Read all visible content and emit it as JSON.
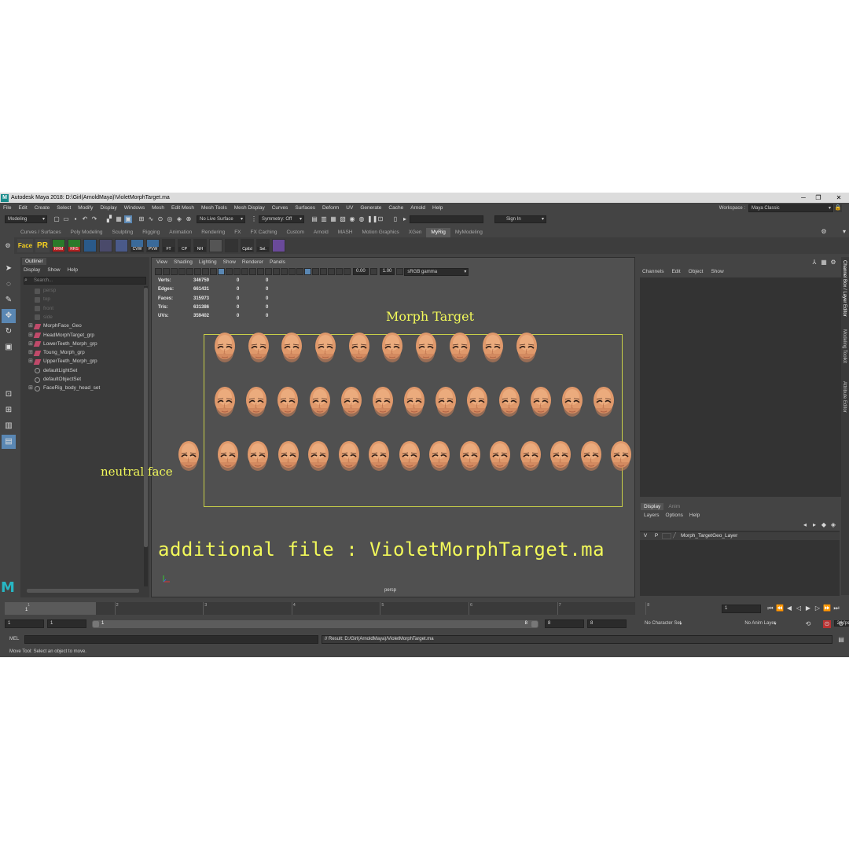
{
  "window": {
    "title": "Autodesk Maya 2018: D:\\Girl(ArnoldMaya)\\VioletMorphTarget.ma",
    "logo": "M"
  },
  "menubar": [
    "File",
    "Edit",
    "Create",
    "Select",
    "Modify",
    "Display",
    "Windows",
    "Mesh",
    "Edit Mesh",
    "Mesh Tools",
    "Mesh Display",
    "Curves",
    "Surfaces",
    "Deform",
    "UV",
    "Generate",
    "Cache",
    "Arnold",
    "Help"
  ],
  "workspace": {
    "label": "Workspace :",
    "value": "Maya Classic"
  },
  "statusline": {
    "mode": "Modeling",
    "live_surface": "No Live Surface",
    "symmetry": "Symmetry: Off",
    "sign_in": "Sign In"
  },
  "shelf_tabs": [
    "Curves / Surfaces",
    "Poly Modeling",
    "Sculpting",
    "Rigging",
    "Animation",
    "Rendering",
    "FX",
    "FX Caching",
    "Custom",
    "Arnold",
    "MASH",
    "Motion Graphics",
    "XGen",
    "MyRig",
    "MyModeling"
  ],
  "shelf_active": "MyRig",
  "shelf_buttons": [
    {
      "label": "Face",
      "icon": "face-icon"
    },
    {
      "label": "PR",
      "icon": "pr-icon"
    },
    {
      "label": "RRM",
      "icon": "rrm-icon"
    },
    {
      "label": "RRS",
      "icon": "rrs-icon"
    },
    {
      "label": "",
      "icon": "arnold-icon"
    },
    {
      "label": "",
      "icon": "grid-icon"
    },
    {
      "label": "",
      "icon": "bone-icon"
    },
    {
      "label": "CVW",
      "icon": "cvw-icon"
    },
    {
      "label": "PVW",
      "icon": "pvw-icon"
    },
    {
      "label": "FT",
      "icon": "ft-icon"
    },
    {
      "label": "CP",
      "icon": "cp-icon"
    },
    {
      "label": "NH",
      "icon": "nh-icon"
    },
    {
      "label": "",
      "icon": "joints-icon"
    },
    {
      "label": "",
      "icon": "script-icon"
    },
    {
      "label": "CpEd",
      "icon": "cped-icon"
    },
    {
      "label": "Sel.",
      "icon": "sel-icon"
    },
    {
      "label": "",
      "icon": "sphere-icon"
    }
  ],
  "outliner": {
    "tab": "Outliner",
    "menu": [
      "Display",
      "Show",
      "Help"
    ],
    "search_placeholder": "Search...",
    "items": [
      {
        "label": "persp",
        "dim": true,
        "expand": false,
        "icon": "camera"
      },
      {
        "label": "top",
        "dim": true,
        "expand": false,
        "icon": "camera"
      },
      {
        "label": "front",
        "dim": true,
        "expand": false,
        "icon": "camera"
      },
      {
        "label": "side",
        "dim": true,
        "expand": false,
        "icon": "camera"
      },
      {
        "label": "MorphFace_Geo",
        "dim": false,
        "expand": true,
        "icon": "group"
      },
      {
        "label": "HeadMorphTarget_grp",
        "dim": false,
        "expand": true,
        "icon": "group"
      },
      {
        "label": "LowerTeeth_Morph_grp",
        "dim": false,
        "expand": true,
        "icon": "group"
      },
      {
        "label": "Toung_Morph_grp",
        "dim": false,
        "expand": true,
        "icon": "group"
      },
      {
        "label": "UpperTeeth_Morph_grp",
        "dim": false,
        "expand": true,
        "icon": "group"
      },
      {
        "label": "defaultLightSet",
        "dim": false,
        "expand": false,
        "icon": "set"
      },
      {
        "label": "defaultObjectSet",
        "dim": false,
        "expand": false,
        "icon": "set"
      },
      {
        "label": "FaceRig_body_head_set",
        "dim": false,
        "expand": true,
        "icon": "set"
      }
    ]
  },
  "viewport": {
    "menu": [
      "View",
      "Shading",
      "Lighting",
      "Show",
      "Renderer",
      "Panels"
    ],
    "exposure": "0.00",
    "gamma": "1.00",
    "color_space": "sRGB gamma",
    "camera": "persp",
    "hud": [
      {
        "label": "Verts:",
        "value": "346759",
        "sel": "0",
        "comp": "0"
      },
      {
        "label": "Edges:",
        "value": "661431",
        "sel": "0",
        "comp": "0"
      },
      {
        "label": "Faces:",
        "value": "315973",
        "sel": "0",
        "comp": "0"
      },
      {
        "label": "Tris:",
        "value": "631386",
        "sel": "0",
        "comp": "0"
      },
      {
        "label": "UVs:",
        "value": "359402",
        "sel": "0",
        "comp": "0"
      }
    ],
    "annotations": {
      "morph_target": "Morph Target",
      "neutral_face": "neutral face",
      "additional_file": "additional file : VioletMorphTarget.ma"
    },
    "head_rows": [
      10,
      13,
      14
    ],
    "skin_color": "#e0996b",
    "annotation_color": "#f2f95a"
  },
  "channel_box": {
    "menu": [
      "Channels",
      "Edit",
      "Object",
      "Show"
    ]
  },
  "side_tabs": [
    "Channel Box / Layer Editor",
    "Modeling Toolkit",
    "Attribute Editor"
  ],
  "layer_editor": {
    "tabs": [
      "Display",
      "Anim"
    ],
    "menu": [
      "Layers",
      "Options",
      "Help"
    ],
    "layer": {
      "v": "V",
      "p": "P",
      "name": "Morph_TargetGeo_Layer"
    }
  },
  "timeline": {
    "ticks": [
      "1",
      "2",
      "3",
      "4",
      "5",
      "6",
      "7",
      "8"
    ],
    "current_frame": "1",
    "current_frame_field": "1"
  },
  "range": {
    "start": "1",
    "playback_start": "1",
    "range_start_label": "1",
    "range_end_label": "8",
    "playback_end": "8",
    "end": "8",
    "character_set": "No Character Set",
    "anim_layer": "No Anim Layer",
    "fps": "24 fps"
  },
  "command": {
    "lang": "MEL",
    "result": "// Result: D:/Girl(ArnoldMaya)/VioletMorphTarget.ma"
  },
  "help_line": "Move Tool: Select an object to move."
}
